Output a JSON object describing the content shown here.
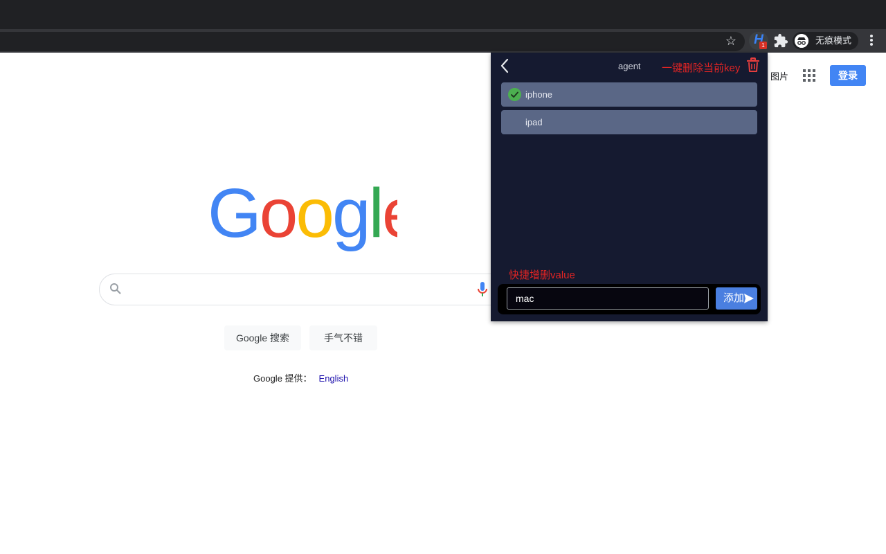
{
  "browser": {
    "incognito_label": "无痕模式",
    "extension_badge": "1",
    "extension_letter": "H"
  },
  "google": {
    "images_link": "图片",
    "signin_label": "登录",
    "search_button": "Google 搜索",
    "lucky_button": "手气不错",
    "offered_in": "Google 提供：",
    "offered_lang": "English",
    "search_value": ""
  },
  "popup": {
    "key_title": "agent",
    "delete_hint": "一键删除当前key",
    "values": [
      {
        "label": "iphone",
        "selected": true
      },
      {
        "label": "ipad",
        "selected": false
      }
    ],
    "add_hint": "快捷增删value",
    "input_value": "mac",
    "add_button": "添加"
  },
  "colors": {
    "popup_bg": "#151a30",
    "item_bg": "#5a6786",
    "accent": "#4a7fe0",
    "hint_red": "#e02424",
    "check_green": "#4caf50"
  }
}
